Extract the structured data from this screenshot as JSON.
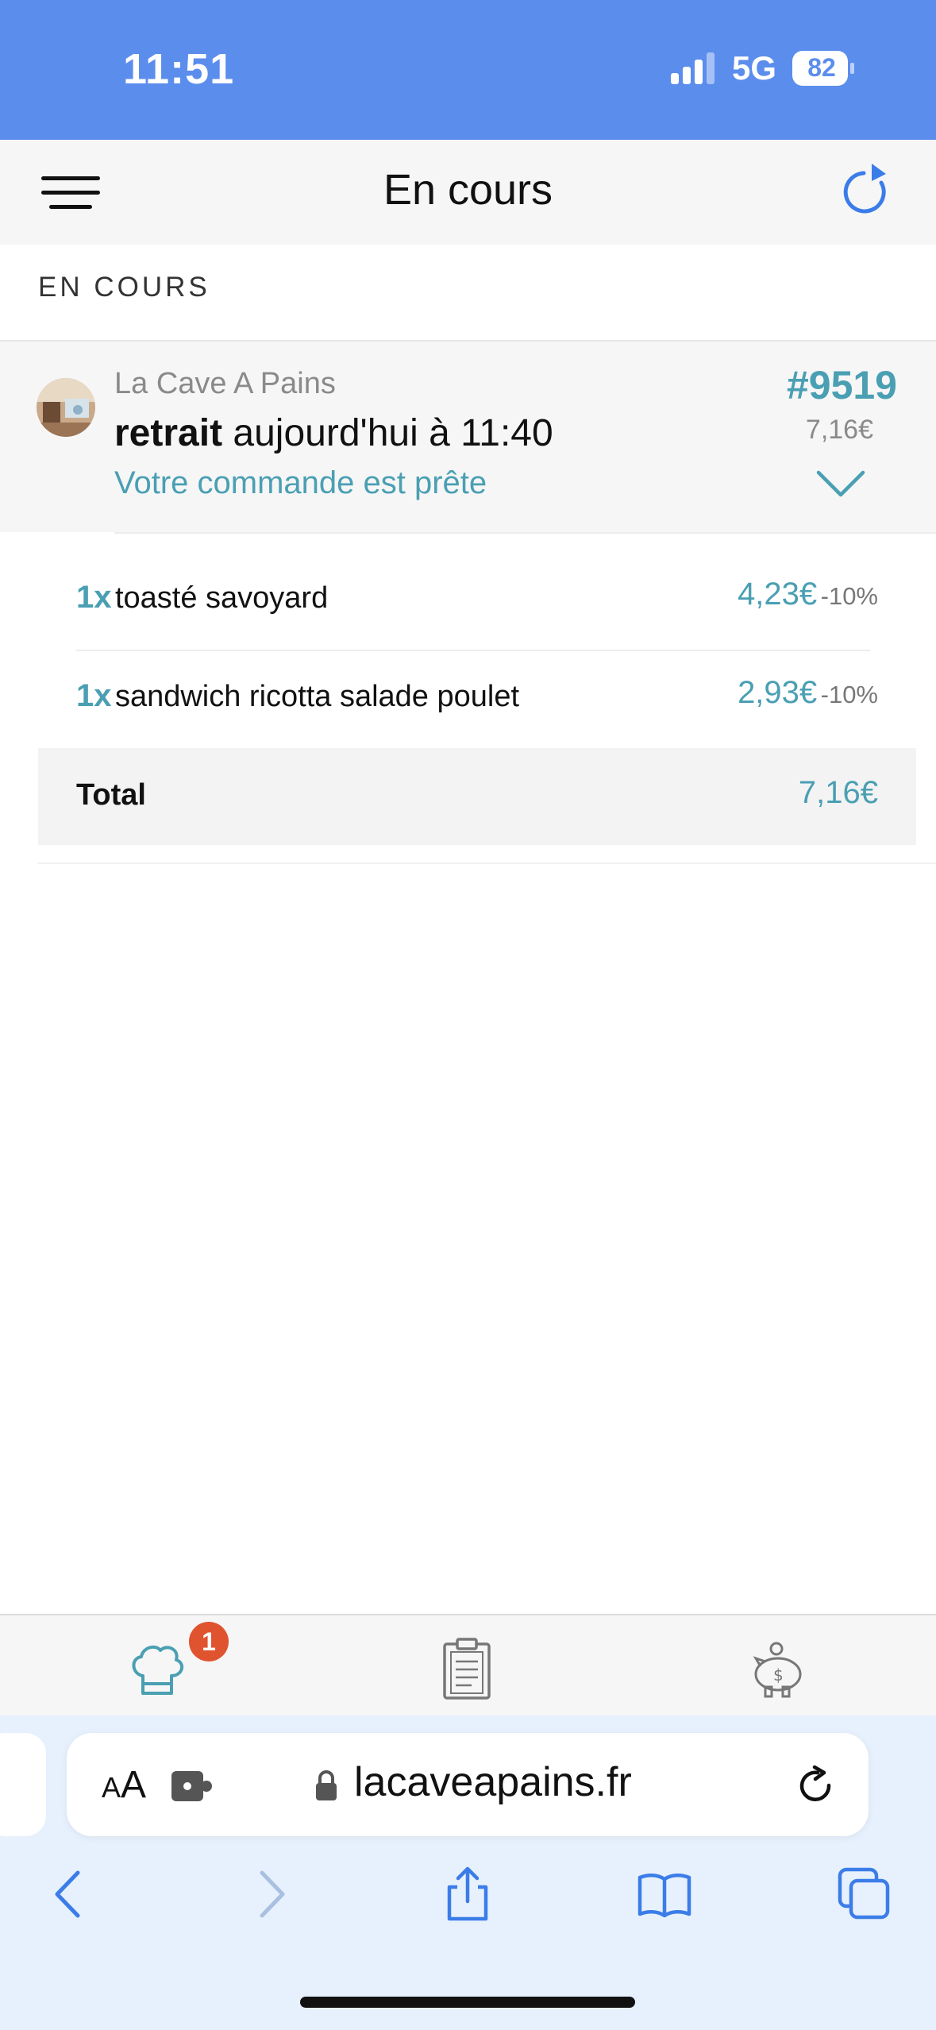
{
  "status_bar": {
    "time": "11:51",
    "network": "5G",
    "battery": "82"
  },
  "header": {
    "title": "En cours"
  },
  "section": {
    "label": "EN COURS"
  },
  "order": {
    "restaurant": "La Cave A Pains",
    "pickup_bold": "retrait",
    "pickup_rest": "aujourd'hui à 11:40",
    "status": "Votre commande est prête",
    "number": "#9519",
    "total": "7,16€"
  },
  "items": [
    {
      "qty": "1x",
      "name": "toasté savoyard",
      "price": "4,23€",
      "discount": "-10%"
    },
    {
      "qty": "1x",
      "name": "sandwich ricotta salade poulet",
      "price": "2,93€",
      "discount": "-10%"
    }
  ],
  "summary": {
    "total_label": "Total",
    "total_value": "7,16€"
  },
  "tabbar": {
    "badge": "1"
  },
  "browser": {
    "aa_small": "A",
    "aa_large": "A",
    "url": "lacaveapains.fr"
  },
  "colors": {
    "accent": "#4a9fb3",
    "statusbar": "#5b8ded",
    "badge": "#e0532f"
  }
}
